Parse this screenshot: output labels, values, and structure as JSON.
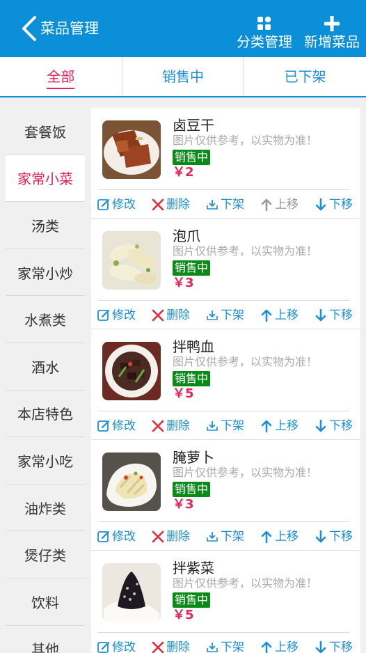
{
  "header": {
    "title": "菜品管理",
    "actions": [
      {
        "label": "分类管理",
        "icon": "category-grid-icon"
      },
      {
        "label": "新增菜品",
        "icon": "plus-icon"
      }
    ]
  },
  "tabs": [
    {
      "label": "全部",
      "active": true
    },
    {
      "label": "销售中",
      "active": false
    },
    {
      "label": "已下架",
      "active": false
    }
  ],
  "categories": [
    {
      "label": "套餐饭",
      "active": false
    },
    {
      "label": "家常小菜",
      "active": true
    },
    {
      "label": "汤类",
      "active": false
    },
    {
      "label": "家常小炒",
      "active": false
    },
    {
      "label": "水煮类",
      "active": false
    },
    {
      "label": "酒水",
      "active": false
    },
    {
      "label": "本店特色",
      "active": false
    },
    {
      "label": "家常小吃",
      "active": false
    },
    {
      "label": "油炸类",
      "active": false
    },
    {
      "label": "煲仔类",
      "active": false
    },
    {
      "label": "饮料",
      "active": false
    },
    {
      "label": "其他",
      "active": false
    }
  ],
  "items": [
    {
      "name": "卤豆干",
      "note": "图片仅供参考，以实物为准！",
      "status": "销售中",
      "price": "￥2",
      "up_disabled": true
    },
    {
      "name": "泡爪",
      "note": "图片仅供参考，以实物为准！",
      "status": "销售中",
      "price": "￥3",
      "up_disabled": false
    },
    {
      "name": "拌鸭血",
      "note": "图片仅供参考，以实物为准！",
      "status": "销售中",
      "price": "￥5",
      "up_disabled": false
    },
    {
      "name": "腌萝卜",
      "note": "图片仅供参考，以实物为准！",
      "status": "销售中",
      "price": "￥3",
      "up_disabled": false
    },
    {
      "name": "拌紫菜",
      "note": "图片仅供参考，以实物为准！",
      "status": "销售中",
      "price": "￥5",
      "up_disabled": false
    }
  ],
  "ops": {
    "edit": "修改",
    "delete": "删除",
    "off_shelf": "下架",
    "move_up": "上移",
    "move_down": "下移"
  },
  "colors": {
    "header_bg": "#0a8fd8",
    "accent_pink": "#e2245b",
    "badge_green": "#0a8a18",
    "link_blue": "#1a8fd6",
    "delete_red": "#e02a3a"
  }
}
